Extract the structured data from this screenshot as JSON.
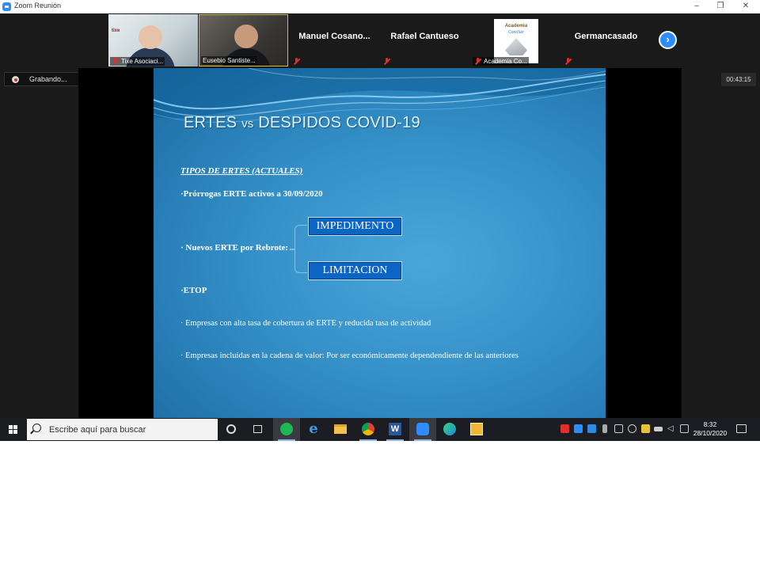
{
  "window": {
    "title": "Zoom Reunión",
    "minimize": "–",
    "restore": "❐",
    "close": "✕"
  },
  "participants": [
    {
      "name": "Tixe Asociaci...",
      "kind": "video",
      "muted": true,
      "brand": "tixe"
    },
    {
      "name": "Eusebio Santiste...",
      "kind": "video",
      "muted": false,
      "active_speaker": true
    },
    {
      "name": "Manuel  Cosano...",
      "kind": "name",
      "muted": true
    },
    {
      "name": "Rafael Cantueso",
      "kind": "name",
      "muted": true
    },
    {
      "name": "Academia Co...",
      "kind": "logo",
      "muted": true,
      "logo_text": "Academia",
      "logo_subtext": "ConoSer"
    },
    {
      "name": "Germancasado",
      "kind": "name",
      "muted": true
    }
  ],
  "recording": {
    "label": "Grabando..."
  },
  "timer": "00:43:15",
  "slide": {
    "title_part1": "ERTES ",
    "title_vs": "vs",
    "title_part2": " DESPIDOS COVID-19",
    "subtitle": "TIPOS DE ERTES (ACTUALES)",
    "bullet1": "·Prórrogas ERTE activos a 30/09/2020",
    "bullet2": "· Nuevos ERTE por Rebrote:",
    "box1": "IMPEDIMENTO",
    "box2": "LIMITACION",
    "bullet3": "·ETOP",
    "bullet4": "· Empresas con alta tasa de cobertura de ERTE y reducida tasa de actividad",
    "bullet5": "· Empresas incluidas en la cadena de valor: Por ser económicamente dependendiente de las anteriores"
  },
  "taskbar": {
    "search_placeholder": "Escribe aquí para buscar",
    "apps": [
      "cortana-icon",
      "task-view-icon",
      "spotify-icon",
      "edge-legacy-icon",
      "file-explorer-icon",
      "chrome-icon",
      "word-icon",
      "zoom-icon",
      "edge-icon",
      "outlook-icon"
    ],
    "time": "8:32",
    "date": "28/10/2020"
  },
  "colors": {
    "zoom_blue": "#2d8cff",
    "slide_blue": "#3590c8",
    "box_blue": "#0c64c4",
    "muted_red": "#e0302a"
  }
}
